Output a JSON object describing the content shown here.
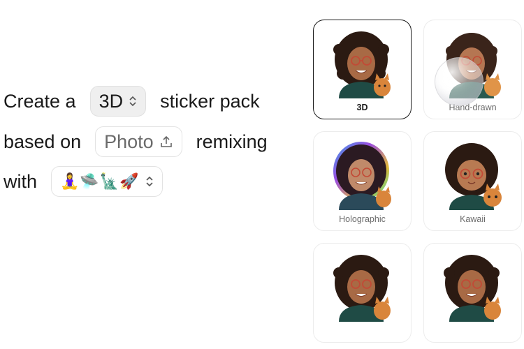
{
  "prompt": {
    "line1": {
      "text_before": "Create a",
      "style_value": "3D",
      "text_after": "sticker pack"
    },
    "line2": {
      "text_before": "based on",
      "source_value": "Photo",
      "text_after": "remixing"
    },
    "line3": {
      "text_before": "with",
      "emoji_value": "🧘‍♀️🛸🗽🚀"
    }
  },
  "icons": {
    "style_select": "chevron-updown-icon",
    "source_upload": "upload-icon",
    "emoji_select": "chevron-updown-icon"
  },
  "styles": [
    {
      "label": "3D",
      "selected": true
    },
    {
      "label": "Hand-drawn",
      "selected": false
    },
    {
      "label": "Holographic",
      "selected": false
    },
    {
      "label": "Kawaii",
      "selected": false
    },
    {
      "label": "",
      "selected": false
    },
    {
      "label": "",
      "selected": false
    }
  ],
  "colors": {
    "selected_border": "#1a1a1a",
    "card_border": "#ececec",
    "pill_fill": "#efefef",
    "hair": "#2b1a12",
    "skin": "#a86a45",
    "shirt": "#1f4b45",
    "cat": "#d9853b",
    "glasses": "#c24a36"
  }
}
